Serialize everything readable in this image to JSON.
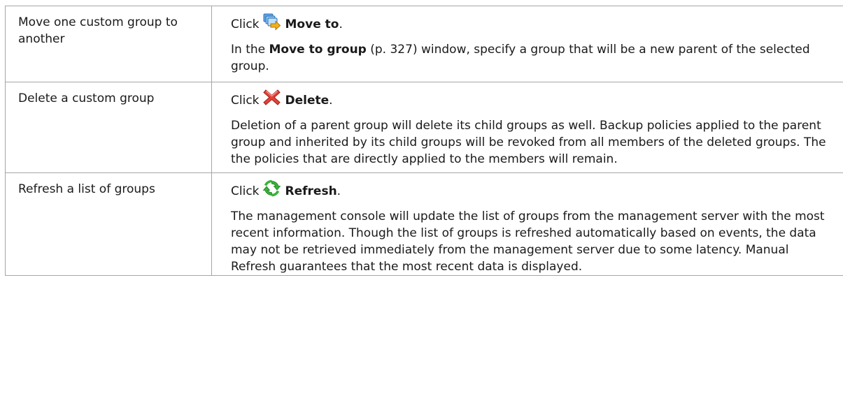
{
  "rows": [
    {
      "task": "Move one custom group to another",
      "click_word": "Click",
      "action_icon": "move-to-icon",
      "action_label": "Move to",
      "action_suffix": ".",
      "desc_prefix": "In the ",
      "desc_bold": "Move to group",
      "desc_rest": " (p. 327) window, specify a group that will be a new parent of the selected group."
    },
    {
      "task": "Delete a custom group",
      "click_word": "Click",
      "action_icon": "delete-icon",
      "action_label": "Delete",
      "action_suffix": ".",
      "desc": "Deletion of a parent group will delete its child groups as well. Backup policies applied to the parent group and inherited by its child groups will be revoked from all members of the deleted groups. The the policies that are directly applied to the members will remain."
    },
    {
      "task": "Refresh a list of groups",
      "click_word": "Click",
      "action_icon": "refresh-icon",
      "action_label": "Refresh",
      "action_suffix": ".",
      "desc": "The management console will update the list of groups from the management server with the most recent information. Though the list of groups is refreshed automatically based on events, the data may not be retrieved immediately from the management server due to some latency. Manual Refresh guarantees that the most recent data is displayed."
    }
  ],
  "colors": {
    "border": "#a6a6a6",
    "delete_icon": "#d9352b",
    "refresh_icon": "#2fa82f",
    "move_icon": "#3b87d6"
  }
}
